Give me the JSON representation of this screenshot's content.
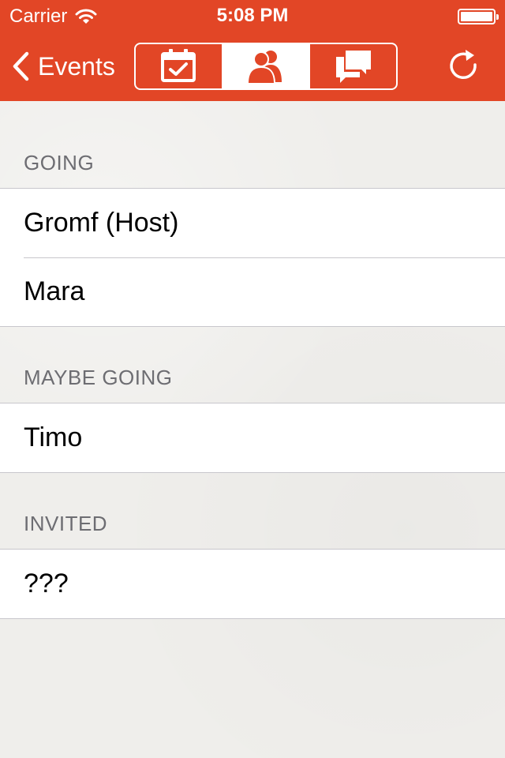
{
  "status_bar": {
    "carrier": "Carrier",
    "time": "5:08 PM",
    "battery_level": 1.0
  },
  "nav": {
    "back_label": "Events",
    "segments": [
      {
        "icon": "calendar-check-icon",
        "selected": false
      },
      {
        "icon": "people-icon",
        "selected": true
      },
      {
        "icon": "chat-bubbles-icon",
        "selected": false
      }
    ],
    "refresh_icon": "refresh-icon"
  },
  "colors": {
    "accent": "#e24626",
    "background": "#efeeeb",
    "section_label": "#6d6d72",
    "separator": "#c8c7cc"
  },
  "sections": [
    {
      "title": "GOING",
      "rows": [
        "Gromf (Host)",
        "Mara"
      ]
    },
    {
      "title": "MAYBE GOING",
      "rows": [
        "Timo"
      ]
    },
    {
      "title": "INVITED",
      "rows": [
        "???"
      ]
    }
  ]
}
